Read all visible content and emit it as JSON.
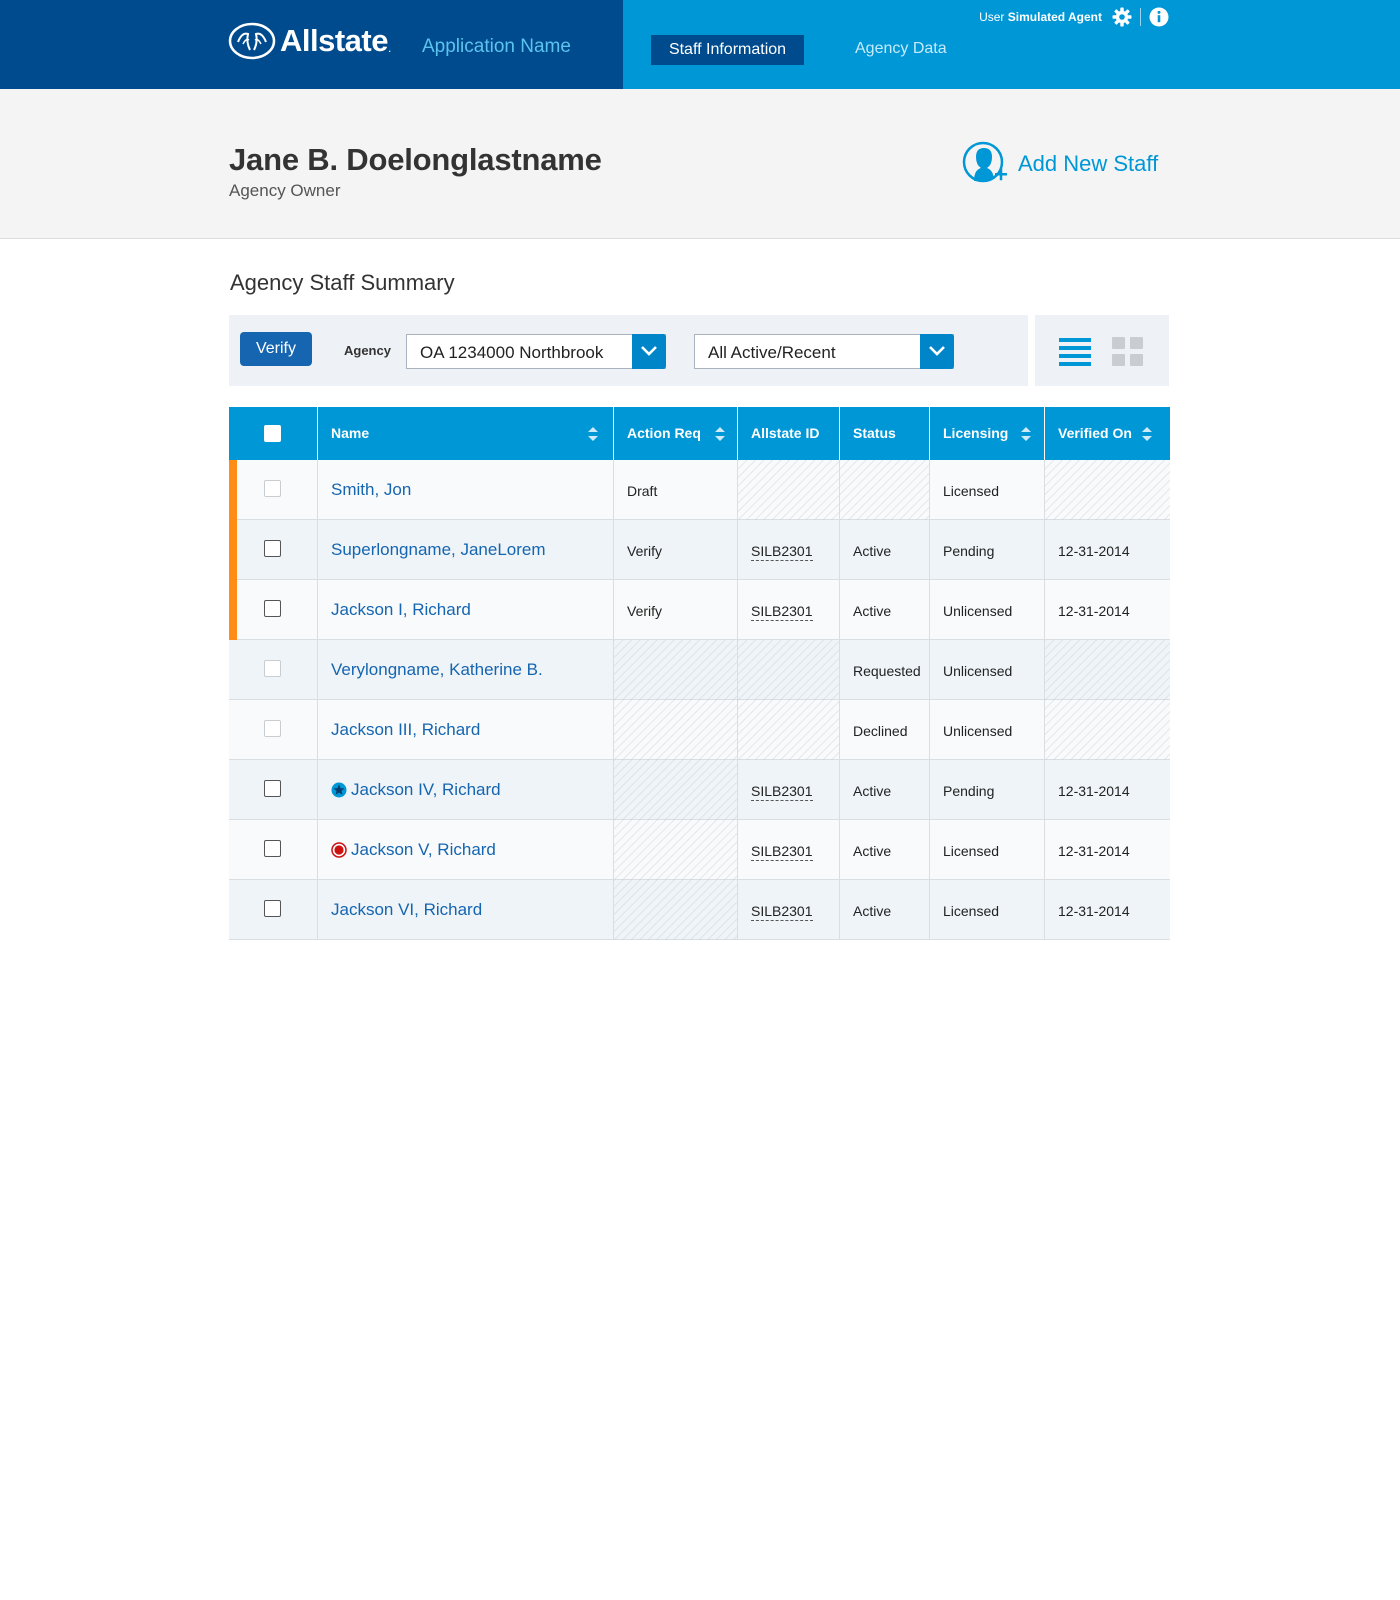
{
  "header": {
    "brand": "Allstate",
    "app_name": "Application Name",
    "nav": [
      {
        "label": "Staff Information",
        "active": true
      },
      {
        "label": "Agency Data",
        "active": false
      }
    ],
    "user_prefix": "User",
    "user_name": "Simulated Agent",
    "icons": [
      "gear-icon",
      "info-icon"
    ]
  },
  "profile": {
    "name": "Jane B. Doelonglastname",
    "role": "Agency Owner",
    "add_staff_label": "Add New Staff"
  },
  "section": {
    "title": "Agency Staff Summary"
  },
  "toolbar": {
    "verify_label": "Verify",
    "agency_label": "Agency",
    "agency_value": "OA 1234000 Northbrook",
    "status_filter_value": "All Active/Recent"
  },
  "table": {
    "columns": [
      "Name",
      "Action Req",
      "Allstate ID",
      "Status",
      "Licensing",
      "Verified On"
    ],
    "rows": [
      {
        "flag": true,
        "checkbox_enabled": false,
        "icon": "",
        "name": "Smith, Jon",
        "action": "Draft",
        "id": "",
        "status": "",
        "licensing": "Licensed",
        "verified": ""
      },
      {
        "flag": true,
        "checkbox_enabled": true,
        "icon": "",
        "name": "Superlongname, JaneLorem",
        "action": "Verify",
        "id": "SILB2301",
        "status": "Active",
        "licensing": "Pending",
        "verified": "12-31-2014"
      },
      {
        "flag": true,
        "checkbox_enabled": true,
        "icon": "",
        "name": "Jackson I, Richard",
        "action": "Verify",
        "id": "SILB2301",
        "status": "Active",
        "licensing": "Unlicensed",
        "verified": "12-31-2014"
      },
      {
        "flag": false,
        "checkbox_enabled": false,
        "icon": "",
        "name": "Verylongname, Katherine B.",
        "action": "",
        "id": "",
        "status": "Requested",
        "licensing": "Unlicensed",
        "verified": ""
      },
      {
        "flag": false,
        "checkbox_enabled": false,
        "icon": "",
        "name": "Jackson III, Richard",
        "action": "",
        "id": "",
        "status": "Declined",
        "licensing": "Unlicensed",
        "verified": ""
      },
      {
        "flag": false,
        "checkbox_enabled": true,
        "icon": "star-badge-icon",
        "name": "Jackson IV, Richard",
        "action": "",
        "id": "SILB2301",
        "status": "Active",
        "licensing": "Pending",
        "verified": "12-31-2014"
      },
      {
        "flag": false,
        "checkbox_enabled": true,
        "icon": "red-dot-icon",
        "name": "Jackson V, Richard",
        "action": "",
        "id": "SILB2301",
        "status": "Active",
        "licensing": "Licensed",
        "verified": "12-31-2014"
      },
      {
        "flag": false,
        "checkbox_enabled": true,
        "icon": "",
        "name": "Jackson VI, Richard",
        "action": "",
        "id": "SILB2301",
        "status": "Active",
        "licensing": "Licensed",
        "verified": "12-31-2014"
      }
    ]
  },
  "colors": {
    "brand_dark": "#004b8d",
    "brand_light": "#0097d6",
    "flag_orange": "#ff8c14",
    "link_blue": "#1565b0"
  }
}
